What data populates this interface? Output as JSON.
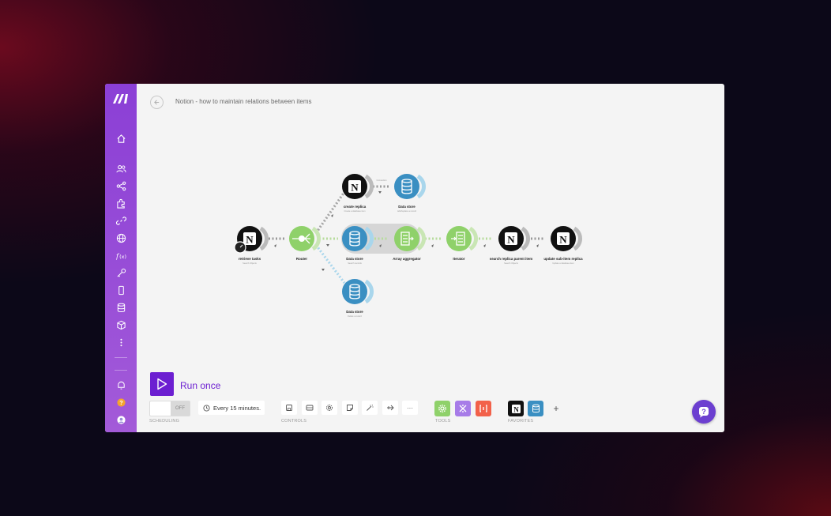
{
  "header": {
    "title": "Notion - how to maintain relations between items"
  },
  "sidebar": {
    "items": [
      {
        "name": "home-icon"
      },
      {
        "name": "team-icon"
      },
      {
        "name": "share-icon"
      },
      {
        "name": "puzzle-icon"
      },
      {
        "name": "link-icon"
      },
      {
        "name": "globe-icon"
      },
      {
        "name": "function-icon"
      },
      {
        "name": "key-icon"
      },
      {
        "name": "phone-icon"
      },
      {
        "name": "database-icon"
      },
      {
        "name": "cube-icon"
      },
      {
        "name": "more-icon"
      }
    ],
    "bottom": [
      {
        "name": "bell-icon"
      },
      {
        "name": "help-circle-icon"
      },
      {
        "name": "user-avatar-icon"
      }
    ]
  },
  "scenario": {
    "nodes": [
      {
        "id": "retrieve",
        "label": "retrieve tasks",
        "sub": "Search Objects",
        "type": "notion"
      },
      {
        "id": "router",
        "label": "Router",
        "sub": "",
        "type": "router"
      },
      {
        "id": "create",
        "label": "create replica",
        "sub": "Create a database item",
        "type": "notion"
      },
      {
        "id": "ds1",
        "label": "Data store",
        "sub": "Add/replace a record",
        "type": "datastore"
      },
      {
        "id": "ds2",
        "label": "Data store",
        "sub": "Search records",
        "type": "datastore"
      },
      {
        "id": "agg",
        "label": "Array aggregator",
        "sub": "",
        "type": "aggregator"
      },
      {
        "id": "iter",
        "label": "Iterator",
        "sub": "",
        "type": "iterator"
      },
      {
        "id": "search",
        "label": "search replica parent item",
        "sub": "Search Objects",
        "type": "notion"
      },
      {
        "id": "update",
        "label": "update sub-item replica",
        "sub": "Update a database item",
        "type": "notion"
      },
      {
        "id": "ds3",
        "label": "Data store",
        "sub": "Delete a record",
        "type": "datastore"
      }
    ],
    "link_label": "Connection"
  },
  "run": {
    "label": "Run once"
  },
  "scheduling": {
    "toggle": "OFF",
    "interval": "Every 15 minutes.",
    "label": "SCHEDULING"
  },
  "controls": {
    "label": "CONTROLS",
    "more": "···"
  },
  "tools": {
    "label": "TOOLS"
  },
  "favorites": {
    "label": "FAVORITES",
    "add": "+"
  },
  "colors": {
    "brand": "#6c1fd1",
    "sidebar": "#9a4fd8",
    "router": "#8fd16a",
    "datastore": "#3a8fc2",
    "notion": "#111111"
  }
}
